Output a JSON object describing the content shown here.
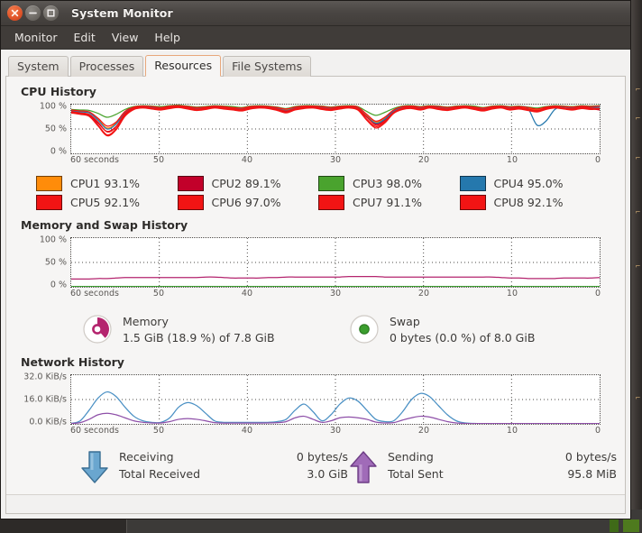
{
  "window": {
    "title": "System Monitor",
    "buttons": [
      {
        "name": "close",
        "glyph": "×"
      },
      {
        "name": "minimize",
        "glyph": "−"
      },
      {
        "name": "maximize",
        "glyph": "□"
      }
    ]
  },
  "menubar": {
    "items": [
      "Monitor",
      "Edit",
      "View",
      "Help"
    ]
  },
  "tabs": [
    {
      "label": "System",
      "active": false
    },
    {
      "label": "Processes",
      "active": false
    },
    {
      "label": "Resources",
      "active": true
    },
    {
      "label": "File Systems",
      "active": false
    }
  ],
  "colors": {
    "accent": "#e8a87c",
    "close_button": "#e2562a",
    "titlebar": "#4a4643",
    "menubar": "#403c39",
    "panel": "#f6f5f4"
  },
  "sections": {
    "cpu": {
      "title": "CPU History",
      "y_ticks": [
        "100 %",
        "50 %",
        "0 %"
      ],
      "x_ticks": [
        "60 seconds",
        "50",
        "40",
        "30",
        "20",
        "10",
        "0"
      ],
      "cpus": [
        {
          "name": "CPU1",
          "value": "93.1%",
          "color": "#ff8c0a"
        },
        {
          "name": "CPU2",
          "value": "89.1%",
          "color": "#c2002a"
        },
        {
          "name": "CPU3",
          "value": "98.0%",
          "color": "#4aa32e"
        },
        {
          "name": "CPU4",
          "value": "95.0%",
          "color": "#2578ad"
        },
        {
          "name": "CPU5",
          "value": "92.1%",
          "color": "#f21414"
        },
        {
          "name": "CPU6",
          "value": "97.0%",
          "color": "#f21414"
        },
        {
          "name": "CPU7",
          "value": "91.1%",
          "color": "#f21414"
        },
        {
          "name": "CPU8",
          "value": "92.1%",
          "color": "#f21414"
        }
      ]
    },
    "memory": {
      "title": "Memory and Swap History",
      "y_ticks": [
        "100 %",
        "50 %",
        "0 %"
      ],
      "x_ticks": [
        "60 seconds",
        "50",
        "40",
        "30",
        "20",
        "10",
        "0"
      ],
      "memory": {
        "icon": "memory-pie-icon",
        "name": "Memory",
        "value": "1.5 GiB (18.9 %) of 7.8 GiB",
        "color": "#b4246e"
      },
      "swap": {
        "icon": "swap-dot-icon",
        "name": "Swap",
        "value": "0 bytes (0.0 %) of 8.0 GiB",
        "color": "#3b9e2e"
      }
    },
    "network": {
      "title": "Network History",
      "y_ticks": [
        "32.0 KiB/s",
        "16.0 KiB/s",
        "0.0 KiB/s"
      ],
      "x_ticks": [
        "60 seconds",
        "50",
        "40",
        "30",
        "20",
        "10",
        "0"
      ],
      "receiving": {
        "icon": "down-arrow-icon",
        "rate_label": "Receiving",
        "rate_value": "0 bytes/s",
        "total_label": "Total Received",
        "total_value": "3.0 GiB",
        "color": "#4a90c4"
      },
      "sending": {
        "icon": "up-arrow-icon",
        "rate_label": "Sending",
        "rate_value": "0 bytes/s",
        "total_label": "Total Sent",
        "total_value": "95.8 MiB",
        "color": "#8e4fa8"
      }
    }
  },
  "chart_data": [
    {
      "type": "line",
      "title": "CPU History",
      "xlabel": "",
      "ylabel": "%",
      "ylim": [
        0,
        100
      ],
      "xlim": [
        60,
        0
      ],
      "x_tick_labels": [
        "60 seconds",
        "50",
        "40",
        "30",
        "20",
        "10",
        "0"
      ],
      "y_tick_labels": [
        "0 %",
        "50 %",
        "100 %"
      ],
      "grid": true,
      "legend_position": "below",
      "series": [
        {
          "name": "CPU1",
          "color": "#ff8c0a",
          "current": 93.1,
          "values": [
            88,
            86,
            84,
            70,
            52,
            62,
            85,
            95,
            97,
            96,
            94,
            97,
            98,
            96,
            93,
            95,
            97,
            96,
            94,
            92,
            95,
            97,
            96,
            93,
            90,
            94,
            96,
            97,
            95,
            93,
            96,
            97,
            94,
            78,
            64,
            72,
            88,
            95,
            96,
            94,
            97,
            95,
            93,
            96,
            97,
            95,
            92,
            96,
            97,
            94,
            96,
            93,
            90,
            95,
            97,
            96,
            94,
            97,
            95,
            93
          ]
        },
        {
          "name": "CPU2",
          "color": "#c2002a",
          "current": 89.1,
          "values": [
            85,
            82,
            78,
            62,
            45,
            55,
            80,
            92,
            95,
            93,
            91,
            94,
            96,
            93,
            90,
            92,
            95,
            93,
            91,
            89,
            93,
            95,
            94,
            90,
            86,
            91,
            94,
            95,
            92,
            90,
            93,
            95,
            91,
            74,
            60,
            68,
            85,
            92,
            94,
            91,
            95,
            92,
            90,
            93,
            95,
            92,
            89,
            93,
            95,
            91,
            93,
            90,
            87,
            92,
            95,
            93,
            91,
            94,
            92,
            89
          ]
        },
        {
          "name": "CPU3",
          "color": "#4aa32e",
          "current": 98.0,
          "values": [
            90,
            89,
            88,
            82,
            74,
            80,
            90,
            96,
            98,
            97,
            96,
            98,
            99,
            97,
            95,
            96,
            98,
            97,
            96,
            94,
            97,
            98,
            97,
            95,
            92,
            96,
            98,
            98,
            97,
            95,
            97,
            98,
            96,
            86,
            78,
            84,
            92,
            97,
            98,
            96,
            98,
            97,
            95,
            97,
            98,
            97,
            94,
            97,
            98,
            96,
            97,
            95,
            93,
            96,
            98,
            97,
            96,
            98,
            97,
            98
          ]
        },
        {
          "name": "CPU4",
          "color": "#2578ad",
          "current": 95.0,
          "values": [
            87,
            85,
            83,
            68,
            50,
            60,
            84,
            94,
            96,
            95,
            93,
            96,
            97,
            95,
            92,
            94,
            96,
            95,
            93,
            91,
            94,
            96,
            95,
            92,
            88,
            93,
            95,
            96,
            94,
            92,
            95,
            96,
            93,
            76,
            62,
            70,
            87,
            94,
            95,
            93,
            96,
            94,
            92,
            95,
            96,
            94,
            91,
            95,
            96,
            93,
            95,
            92,
            58,
            66,
            90,
            95,
            93,
            96,
            94,
            95
          ]
        },
        {
          "name": "CPU5",
          "color": "#f21414",
          "current": 92.1,
          "values": [
            84,
            81,
            77,
            58,
            38,
            50,
            78,
            91,
            94,
            92,
            90,
            93,
            95,
            92,
            89,
            91,
            94,
            92,
            90,
            88,
            92,
            94,
            93,
            89,
            84,
            90,
            93,
            94,
            91,
            89,
            92,
            94,
            90,
            70,
            55,
            64,
            83,
            91,
            93,
            90,
            94,
            91,
            89,
            92,
            94,
            91,
            88,
            92,
            94,
            90,
            92,
            89,
            86,
            91,
            94,
            92,
            90,
            93,
            91,
            92
          ]
        },
        {
          "name": "CPU6",
          "color": "#f21414",
          "current": 97.0,
          "values": [
            89,
            87,
            85,
            72,
            56,
            64,
            86,
            95,
            97,
            96,
            94,
            97,
            98,
            96,
            94,
            95,
            97,
            96,
            94,
            93,
            96,
            97,
            96,
            94,
            91,
            95,
            97,
            97,
            96,
            94,
            96,
            97,
            95,
            80,
            66,
            74,
            89,
            96,
            97,
            95,
            97,
            96,
            94,
            96,
            97,
            95,
            93,
            96,
            97,
            95,
            96,
            94,
            91,
            95,
            97,
            96,
            95,
            97,
            96,
            97
          ]
        },
        {
          "name": "CPU7",
          "color": "#f21414",
          "current": 91.1,
          "values": [
            83,
            80,
            76,
            56,
            36,
            48,
            76,
            90,
            93,
            91,
            89,
            92,
            94,
            91,
            88,
            90,
            93,
            91,
            89,
            87,
            91,
            93,
            92,
            88,
            83,
            89,
            92,
            93,
            90,
            88,
            91,
            93,
            89,
            68,
            52,
            62,
            82,
            90,
            92,
            89,
            93,
            90,
            88,
            91,
            93,
            90,
            87,
            91,
            93,
            89,
            91,
            88,
            85,
            90,
            93,
            91,
            89,
            92,
            90,
            91
          ]
        },
        {
          "name": "CPU8",
          "color": "#f21414",
          "current": 92.1,
          "values": [
            86,
            83,
            80,
            64,
            44,
            54,
            82,
            93,
            95,
            93,
            92,
            95,
            96,
            94,
            91,
            93,
            95,
            94,
            92,
            90,
            94,
            95,
            94,
            91,
            87,
            92,
            95,
            95,
            93,
            91,
            94,
            95,
            92,
            75,
            58,
            66,
            84,
            93,
            95,
            92,
            95,
            93,
            91,
            94,
            95,
            93,
            90,
            94,
            95,
            92,
            94,
            91,
            88,
            93,
            95,
            93,
            92,
            95,
            93,
            92
          ]
        }
      ]
    },
    {
      "type": "line",
      "title": "Memory and Swap History",
      "ylim": [
        0,
        100
      ],
      "xlim": [
        60,
        0
      ],
      "x_tick_labels": [
        "60 seconds",
        "50",
        "40",
        "30",
        "20",
        "10",
        "0"
      ],
      "y_tick_labels": [
        "0 %",
        "50 %",
        "100 %"
      ],
      "grid": true,
      "series": [
        {
          "name": "Memory",
          "color": "#b4246e",
          "current": 18.9,
          "values": [
            16,
            16,
            16,
            17,
            17,
            18,
            19,
            19,
            19,
            19,
            19,
            19,
            19,
            19,
            19,
            20,
            20,
            19,
            18,
            18,
            18,
            18,
            19,
            19,
            20,
            20,
            20,
            20,
            20,
            20,
            20,
            21,
            21,
            21,
            21,
            20,
            20,
            20,
            20,
            20,
            20,
            20,
            20,
            20,
            20,
            20,
            20,
            20,
            19,
            18,
            18,
            17,
            17,
            17,
            17,
            18,
            18,
            18,
            18,
            19
          ]
        },
        {
          "name": "Swap",
          "color": "#3b9e2e",
          "current": 0.0,
          "values": [
            0,
            0,
            0,
            0,
            0,
            0,
            0,
            0,
            0,
            0,
            0,
            0,
            0,
            0,
            0,
            0,
            0,
            0,
            0,
            0,
            0,
            0,
            0,
            0,
            0,
            0,
            0,
            0,
            0,
            0,
            0,
            0,
            0,
            0,
            0,
            0,
            0,
            0,
            0,
            0,
            0,
            0,
            0,
            0,
            0,
            0,
            0,
            0,
            0,
            0,
            0,
            0,
            0,
            0,
            0,
            0,
            0,
            0,
            0,
            0
          ]
        }
      ]
    },
    {
      "type": "line",
      "title": "Network History",
      "ylim": [
        0,
        32
      ],
      "xlim": [
        60,
        0
      ],
      "x_tick_labels": [
        "60 seconds",
        "50",
        "40",
        "30",
        "20",
        "10",
        "0"
      ],
      "y_tick_labels": [
        "0.0 KiB/s",
        "16.0 KiB/s",
        "32.0 KiB/s"
      ],
      "grid": true,
      "series": [
        {
          "name": "Receiving",
          "color": "#4a90c4",
          "current": 0,
          "values": [
            0.3,
            2,
            9,
            17,
            21,
            18,
            11,
            5,
            2,
            1,
            1,
            4,
            11,
            14,
            12,
            7,
            2,
            1,
            1,
            1,
            1,
            1,
            1,
            1.5,
            3,
            9,
            13,
            8,
            2,
            6,
            13,
            17,
            15,
            9,
            3,
            1.5,
            2,
            8,
            16,
            20,
            18,
            12,
            6,
            2,
            0.6,
            0.3,
            0.2,
            0.2,
            0.2,
            0.2,
            0.2,
            0.2,
            0.2,
            0.2,
            0.2,
            0.2,
            0.2,
            0.2,
            0.2,
            0.2
          ]
        },
        {
          "name": "Sending",
          "color": "#8e4fa8",
          "current": 0,
          "values": [
            0.2,
            0.8,
            3,
            6,
            7,
            6,
            4,
            2,
            1,
            0.6,
            0.6,
            1.5,
            3,
            3.5,
            3,
            2,
            0.8,
            0.5,
            0.5,
            0.5,
            0.5,
            0.5,
            0.6,
            0.8,
            1.5,
            4,
            5,
            3,
            1,
            2,
            4,
            4.5,
            4,
            3,
            1.2,
            0.6,
            0.8,
            2.5,
            4,
            5,
            4.5,
            3,
            1.5,
            0.6,
            0.3,
            0.2,
            0.2,
            0.2,
            0.2,
            0.2,
            0.2,
            0.2,
            0.2,
            0.2,
            0.2,
            0.2,
            0.2,
            0.2,
            0.2,
            0.2
          ]
        }
      ]
    }
  ]
}
